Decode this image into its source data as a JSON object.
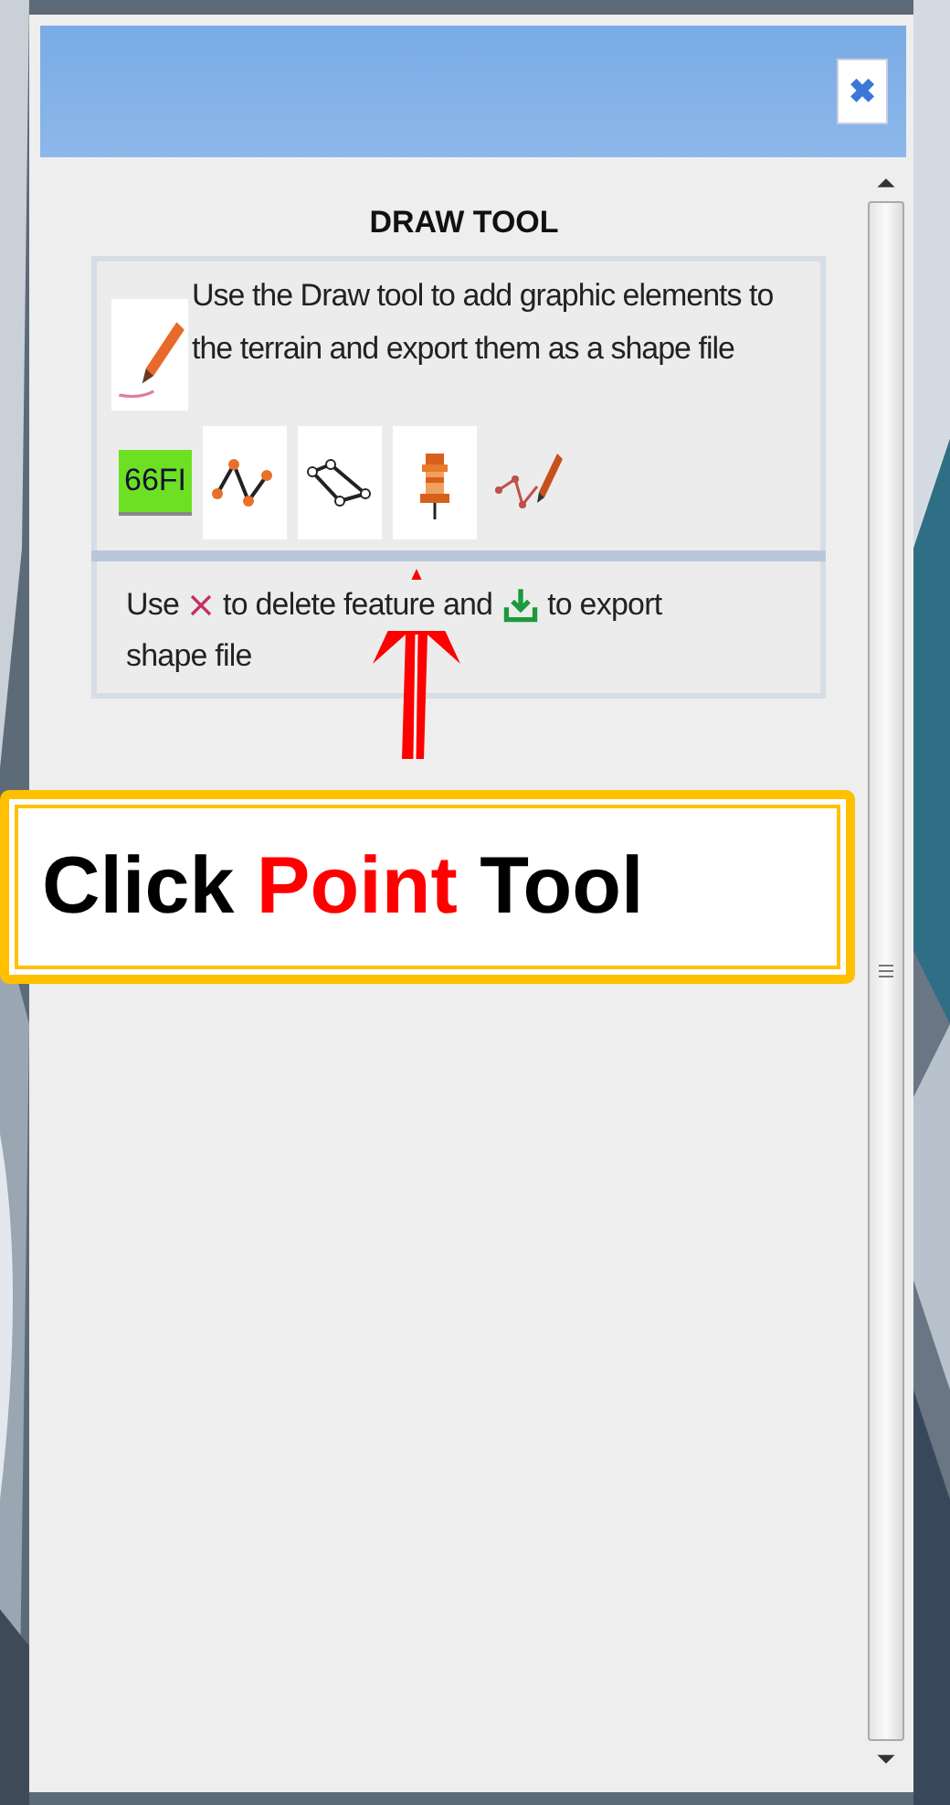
{
  "panel": {
    "close": "✖",
    "title": "DRAW TOOL",
    "intro": "Use the Draw tool to add graphic elements to the terrain and export them as a shape file",
    "tools": [
      {
        "kind": "swatch",
        "label": "66FI"
      },
      {
        "kind": "line"
      },
      {
        "kind": "polygon"
      },
      {
        "kind": "point"
      },
      {
        "kind": "freehand"
      }
    ],
    "hint": {
      "lines": [
        [
          {
            "kind": "text",
            "text": "Use"
          },
          {
            "kind": "delete-icon"
          },
          {
            "kind": "text",
            "text": "to delete feature and"
          },
          {
            "kind": "export-icon"
          },
          {
            "kind": "text",
            "text": "to export"
          }
        ],
        [
          {
            "kind": "text",
            "text": "shape file"
          }
        ]
      ]
    }
  },
  "callout": {
    "parts": [
      {
        "text": "Click",
        "emphasis": false
      },
      {
        "text": "Point",
        "emphasis": true
      },
      {
        "text": "Tool",
        "emphasis": false
      }
    ]
  }
}
